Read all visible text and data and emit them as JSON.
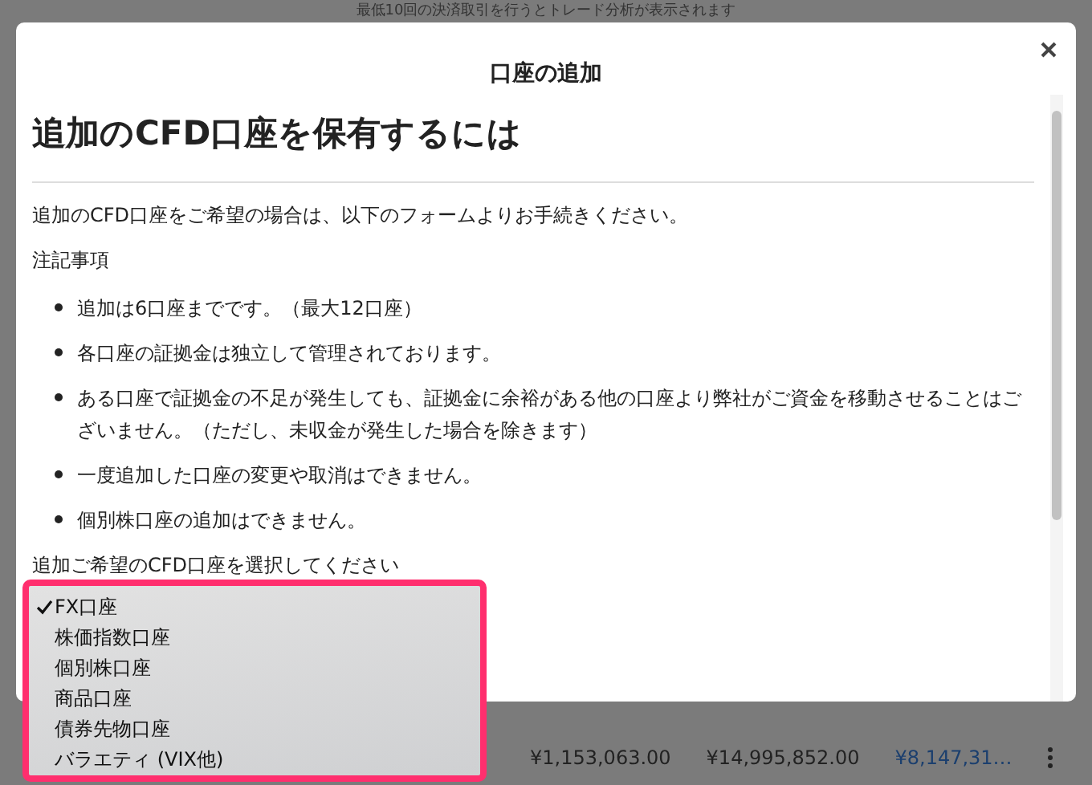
{
  "background": {
    "notice": "最低10回の決済取引を行うとトレード分析が表示されます",
    "row_cells": [
      "¥1,153,063.00",
      "¥14,995,852.00",
      "¥8,147,31…"
    ]
  },
  "dialog": {
    "title": "口座の追加",
    "heading": "追加のCFD口座を保有するには",
    "intro": "追加のCFD口座をご希望の場合は、以下のフォームよりお手続きください。",
    "notes_label": "注記事項",
    "notes": [
      "追加は6口座までです。（最大12口座）",
      "各口座の証拠金は独立して管理されております。",
      "ある口座で証拠金の不足が発生しても、証拠金に余裕がある他の口座より弊社がご資金を移動させることはございません。（ただし、未収金が発生した場合を除きます）",
      "一度追加した口座の変更や取消はできません。",
      "個別株口座の追加はできません。"
    ],
    "select_prompt": "追加ご希望のCFD口座を選択してください"
  },
  "dropdown": {
    "options": [
      {
        "label": "FX口座",
        "selected": true
      },
      {
        "label": "株価指数口座",
        "selected": false
      },
      {
        "label": "個別株口座",
        "selected": false
      },
      {
        "label": "商品口座",
        "selected": false
      },
      {
        "label": "債券先物口座",
        "selected": false
      },
      {
        "label": "バラエティ (VIX他)",
        "selected": false
      }
    ]
  }
}
